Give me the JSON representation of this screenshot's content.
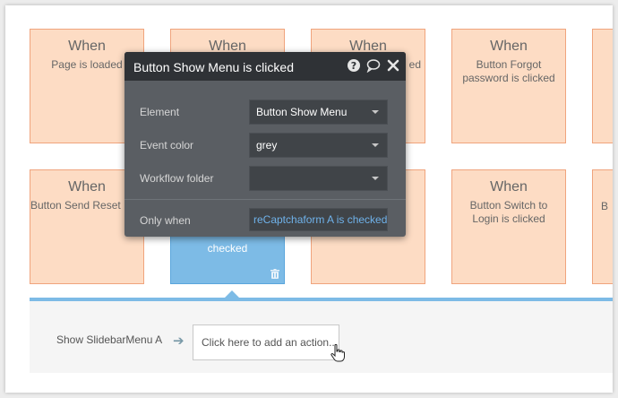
{
  "cards": [
    {
      "when": "When",
      "desc": "Page is loaded"
    },
    {
      "when": "When",
      "desc": ""
    },
    {
      "when": "When",
      "desc": "ed"
    },
    {
      "when": "When",
      "desc": "Button Forgot password is clicked"
    },
    {
      "when": "When",
      "desc": "Button Send Reset Link is clicked"
    },
    {
      "when": "",
      "desc": "checked"
    },
    {
      "when": "When",
      "desc": "Button Switch to Login is clicked"
    },
    {
      "when": "",
      "desc": "B"
    }
  ],
  "popup": {
    "title": "Button Show Menu is clicked",
    "element_label": "Element",
    "element_value": "Button Show Menu",
    "color_label": "Event color",
    "color_value": "grey",
    "folder_label": "Workflow folder",
    "folder_value": "",
    "only_when_label": "Only when",
    "only_when_value": "reCaptchaform A is checked"
  },
  "workflow": {
    "step_label": "Show SlidebarMenu A",
    "add_action": "Click here to add an action..."
  },
  "colors": {
    "card_bg": "#fddcc4",
    "card_border": "#f0a47d",
    "selected_card": "#7dbbe6",
    "popup_bg": "#5a5e63",
    "popup_header": "#2f3236",
    "link_blue": "#6fb2ea"
  },
  "icons": [
    "help-icon",
    "comment-icon",
    "close-icon",
    "trash-icon",
    "arrow-right-icon",
    "hand-cursor-icon"
  ]
}
